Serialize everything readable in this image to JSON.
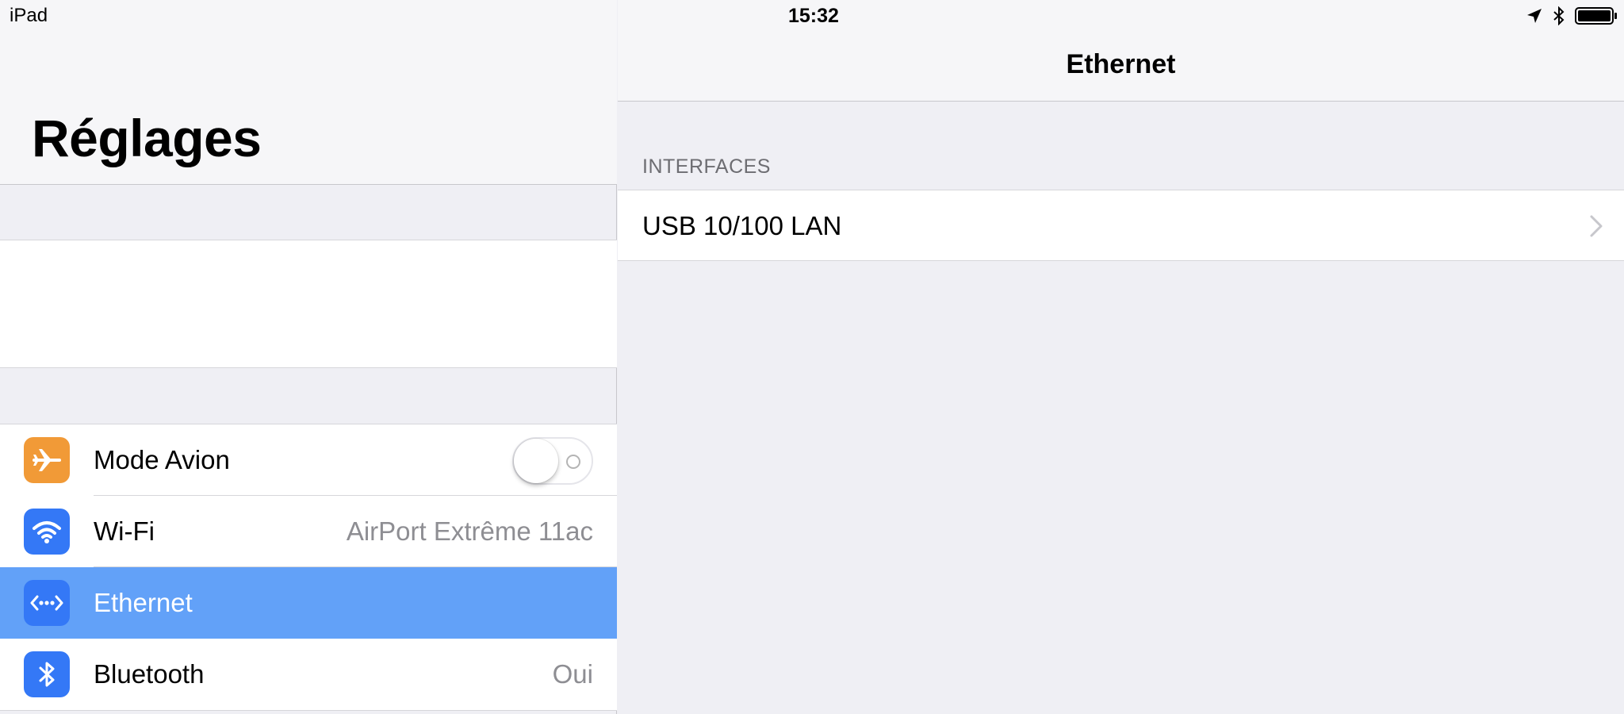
{
  "status_bar": {
    "device": "iPad",
    "time": "15:32"
  },
  "left_pane": {
    "title": "Réglages",
    "items": [
      {
        "label": "Mode Avion",
        "value": "",
        "icon": "airplane-icon",
        "icon_color": "#f19a37",
        "toggle": false,
        "selected": false
      },
      {
        "label": "Wi-Fi",
        "value": "AirPort Extrême 11ac",
        "icon": "wifi-icon",
        "icon_color": "#3478f6",
        "selected": false
      },
      {
        "label": "Ethernet",
        "value": "",
        "icon": "ethernet-icon",
        "icon_color": "#3478f6",
        "selected": true
      },
      {
        "label": "Bluetooth",
        "value": "Oui",
        "icon": "bluetooth-icon",
        "icon_color": "#3478f6",
        "selected": false
      }
    ]
  },
  "right_pane": {
    "title": "Ethernet",
    "section_header": "INTERFACES",
    "interfaces": [
      {
        "label": "USB 10/100 LAN"
      }
    ]
  },
  "colors": {
    "selected_row": "#62a1f8",
    "airplane": "#f19a37",
    "blue_icon": "#3478f6"
  }
}
